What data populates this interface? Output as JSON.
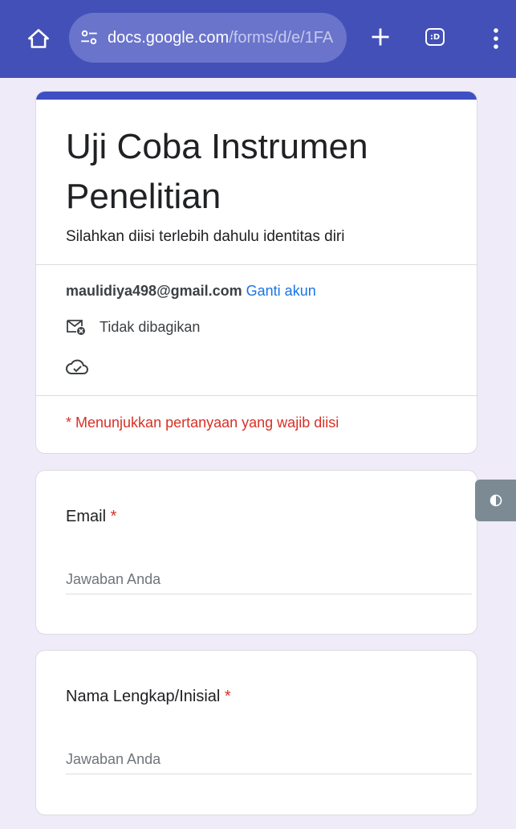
{
  "browser": {
    "url_host": "docs.google.com",
    "url_path": "/forms/d/e/1FA",
    "extension_label": ":D"
  },
  "form": {
    "title": "Uji Coba Instrumen Penelitian",
    "description": "Silahkan diisi terlebih dahulu identitas diri",
    "account_email": "maulidiya498@gmail.com",
    "switch_account": "Ganti akun",
    "not_shared": "Tidak dibagikan",
    "required_note": "* Menunjukkan pertanyaan yang wajib diisi"
  },
  "questions": [
    {
      "label": "Email",
      "required_mark": "*",
      "placeholder": "Jawaban Anda"
    },
    {
      "label": "Nama Lengkap/Inisial",
      "required_mark": "*",
      "placeholder": "Jawaban Anda"
    }
  ],
  "colors": {
    "browser_bar": "#4350b8",
    "accent": "#3f4fc3",
    "background": "#f0ebf8",
    "required": "#d93025",
    "link": "#1a73e8"
  }
}
